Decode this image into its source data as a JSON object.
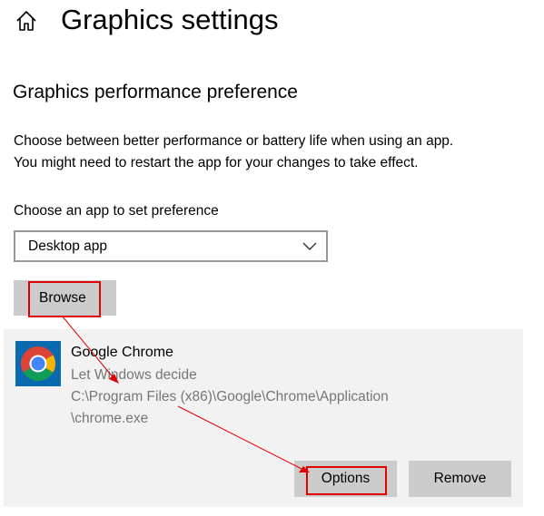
{
  "header": {
    "title": "Graphics settings",
    "home_icon": "home-icon"
  },
  "section": {
    "title": "Graphics performance preference",
    "description_line1": "Choose between better performance or battery life when using an app.",
    "description_line2": "You might need to restart the app for your changes to take effect."
  },
  "app_chooser": {
    "label": "Choose an app to set preference",
    "selected": "Desktop app",
    "browse_label": "Browse"
  },
  "app_entry": {
    "name": "Google Chrome",
    "preference": "Let Windows decide",
    "path_line1": "C:\\Program Files (x86)\\Google\\Chrome\\Application",
    "path_line2": "\\chrome.exe",
    "icon": "chrome-icon",
    "options_label": "Options",
    "remove_label": "Remove"
  },
  "colors": {
    "annotation": "#e00000",
    "button_bg": "#cccccc",
    "panel_bg": "#f2f2f2",
    "secondary_text": "#767676"
  }
}
